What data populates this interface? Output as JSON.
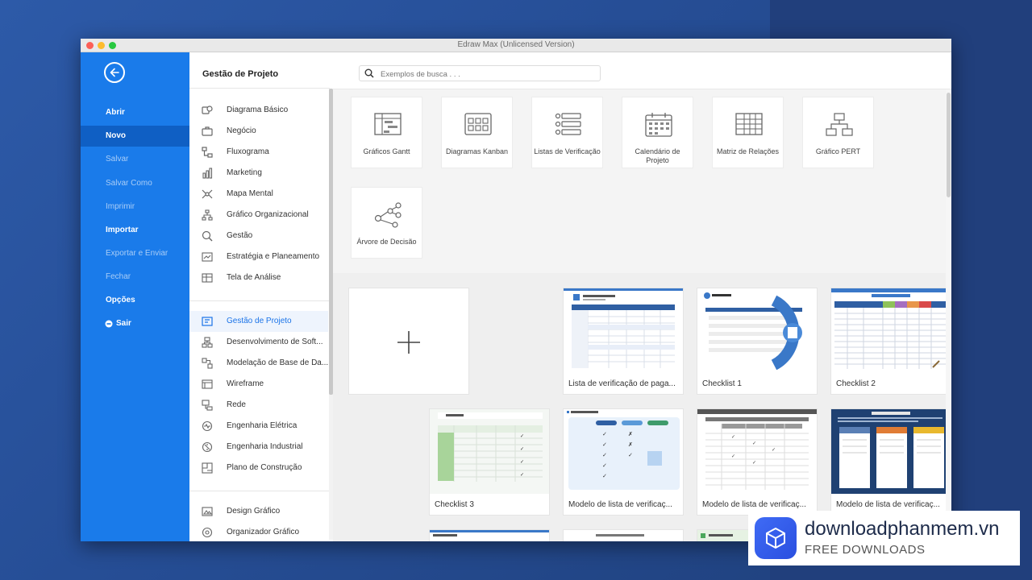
{
  "window": {
    "title": "Edraw Max (Unlicensed Version)"
  },
  "sidebar": {
    "back_icon": "arrow-left-icon",
    "items": [
      {
        "label": "Abrir"
      },
      {
        "label": "Novo"
      },
      {
        "label": "Salvar"
      },
      {
        "label": "Salvar Como"
      },
      {
        "label": "Imprimir"
      },
      {
        "label": "Importar"
      },
      {
        "label": "Exportar e Enviar"
      },
      {
        "label": "Fechar"
      },
      {
        "label": "Opções"
      },
      {
        "label": "Sair"
      }
    ]
  },
  "categories": {
    "title": "Gestão de Projeto",
    "items": [
      {
        "label": "Diagrama Básico"
      },
      {
        "label": "Negócio"
      },
      {
        "label": "Fluxograma"
      },
      {
        "label": "Marketing"
      },
      {
        "label": "Mapa Mental"
      },
      {
        "label": "Gráfico Organizacional"
      },
      {
        "label": "Gestão"
      },
      {
        "label": "Estratégia e Planeamento"
      },
      {
        "label": "Tela de Análise"
      },
      {
        "label": "Gestão de Projeto"
      },
      {
        "label": "Desenvolvimento de Soft..."
      },
      {
        "label": "Modelação de Base de Da..."
      },
      {
        "label": "Wireframe"
      },
      {
        "label": "Rede"
      },
      {
        "label": "Engenharia Elétrica"
      },
      {
        "label": "Engenharia Industrial"
      },
      {
        "label": "Plano de Construção"
      },
      {
        "label": "Design Gráfico"
      },
      {
        "label": "Organizador Gráfico"
      }
    ]
  },
  "search": {
    "placeholder": "Exemplos de busca . . ."
  },
  "templates": [
    {
      "label": "Gráficos Gantt",
      "icon": "gantt-chart-icon"
    },
    {
      "label": "Diagramas Kanban",
      "icon": "kanban-icon"
    },
    {
      "label": "Listas de Verificação",
      "icon": "checklist-icon"
    },
    {
      "label": "Calendário de Projeto",
      "icon": "calendar-icon"
    },
    {
      "label": "Matriz de Relações",
      "icon": "matrix-icon"
    },
    {
      "label": "Gráfico PERT",
      "icon": "pert-chart-icon"
    },
    {
      "label": "Árvore de Decisão",
      "icon": "decision-tree-icon"
    }
  ],
  "gallery": {
    "new_icon": "plus-icon",
    "cards": [
      {
        "label": "Lista de verificação de paga..."
      },
      {
        "label": "Checklist 1"
      },
      {
        "label": "Checklist 2"
      },
      {
        "label": "Checklist 3"
      },
      {
        "label": "Modelo de lista de verificaç..."
      },
      {
        "label": "Modelo de lista de verificaç..."
      },
      {
        "label": "Modelo de lista de verificaç..."
      }
    ]
  },
  "watermark": {
    "name": "downloadphanmem.vn",
    "tagline": "FREE DOWNLOADS"
  },
  "colors": {
    "sidebar": "#1a7bea",
    "sidebar_active": "#0f5fc4",
    "accent": "#1a73e8"
  }
}
